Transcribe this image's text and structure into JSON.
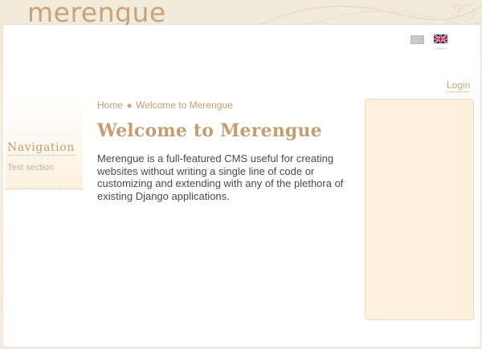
{
  "header": {
    "logo_text": "merengue",
    "languages": [
      {
        "name": "gray-flag-icon",
        "selected": false
      },
      {
        "name": "uk-flag-icon",
        "selected": true
      }
    ],
    "login_label": "Login"
  },
  "navigation": {
    "title": "Navigation",
    "items": [
      {
        "label": "Test section"
      }
    ]
  },
  "breadcrumb": {
    "items": [
      "Home",
      "Welcome to Merengue"
    ]
  },
  "content": {
    "title": "Welcome to Merengue",
    "body": "Merengue is a full-featured CMS useful for creating websites without writing a single line of code or customizing and extending with any of the plethora of existing Django applications."
  },
  "colors": {
    "accent": "#c39e70",
    "page_background": "#f3ede1",
    "sidebar_background": "#fdf0dd",
    "text": "#4a4a4a"
  }
}
